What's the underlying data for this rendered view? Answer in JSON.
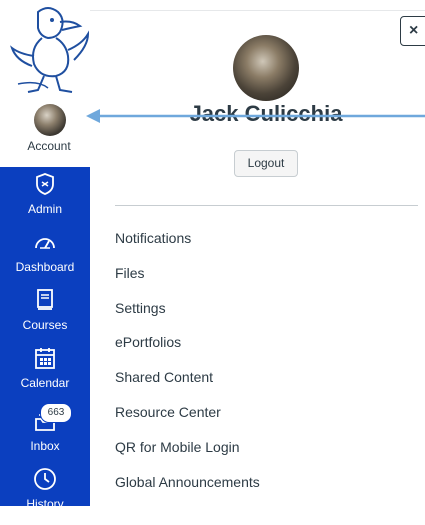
{
  "nav": {
    "account_label": "Account",
    "items": [
      {
        "label": "Admin",
        "icon": "shield-icon"
      },
      {
        "label": "Dashboard",
        "icon": "dashboard-gauge-icon"
      },
      {
        "label": "Courses",
        "icon": "courses-book-icon"
      },
      {
        "label": "Calendar",
        "icon": "calendar-icon"
      },
      {
        "label": "Inbox",
        "icon": "inbox-icon",
        "badge": "663"
      },
      {
        "label": "History",
        "icon": "clock-icon"
      }
    ]
  },
  "tray": {
    "close_label": "×",
    "user_name": "Jack Culicchia",
    "logout_label": "Logout",
    "links": [
      "Notifications",
      "Files",
      "Settings",
      "ePortfolios",
      "Shared Content",
      "Resource Center",
      "QR for Mobile Login",
      "Global Announcements"
    ]
  },
  "colors": {
    "nav_bg": "#0b3fbf",
    "text": "#2d3b45",
    "annotation_arrow": "#6fa8dc"
  }
}
